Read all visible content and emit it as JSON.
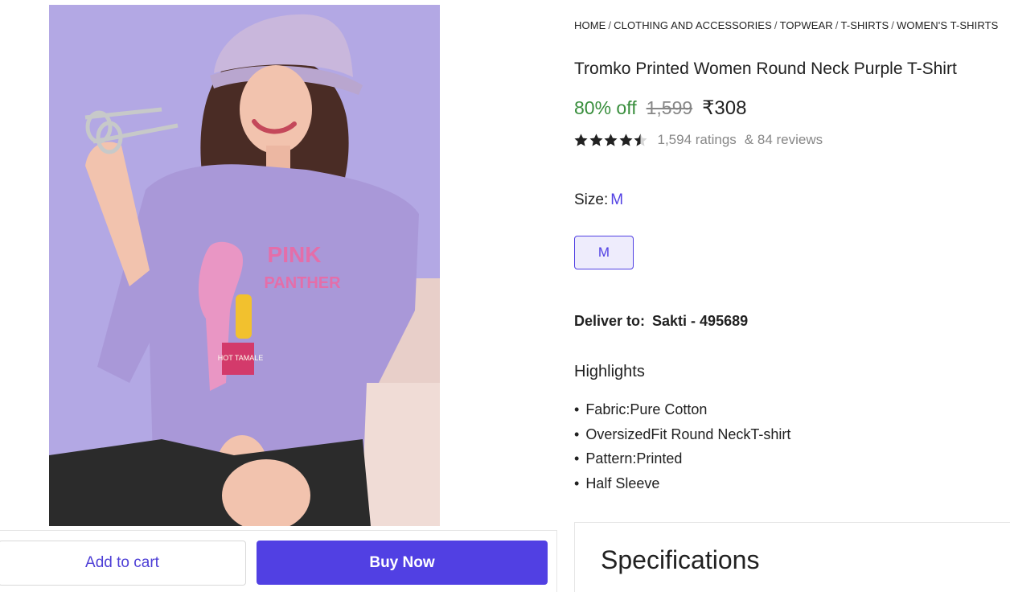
{
  "breadcrumb": [
    {
      "label": "HOME"
    },
    {
      "label": "CLOTHING AND ACCESSORIES"
    },
    {
      "label": "TOPWEAR"
    },
    {
      "label": "T-SHIRTS"
    },
    {
      "label": "WOMEN'S T-SHIRTS"
    }
  ],
  "product": {
    "title": "Tromko Printed Women Round Neck Purple T-Shirt",
    "discount": "80% off",
    "mrp": "1,599",
    "price": "₹308",
    "rating_value": 4.5,
    "ratings_text": "1,594 ratings",
    "reviews_text": "& 84 reviews",
    "print_text_line1": "PINK",
    "print_text_line2": "PANTHER",
    "print_box_text": "HOT TAMALE"
  },
  "size": {
    "label": "Size:",
    "selected": "M",
    "options": [
      "M"
    ]
  },
  "delivery": {
    "label": "Deliver to:",
    "address": "Sakti - 495689"
  },
  "highlights": {
    "title": "Highlights",
    "items": [
      "Fabric:Pure Cotton",
      "OversizedFit Round NeckT-shirt",
      "Pattern:Printed",
      "Half Sleeve"
    ]
  },
  "actions": {
    "add_to_cart": "Add to cart",
    "buy_now": "Buy Now"
  },
  "specifications": {
    "title": "Specifications"
  },
  "colors": {
    "accent": "#5140e3",
    "discount_green": "#388e3c",
    "muted_grey": "#878787",
    "image_background": "#b3a8e4"
  }
}
